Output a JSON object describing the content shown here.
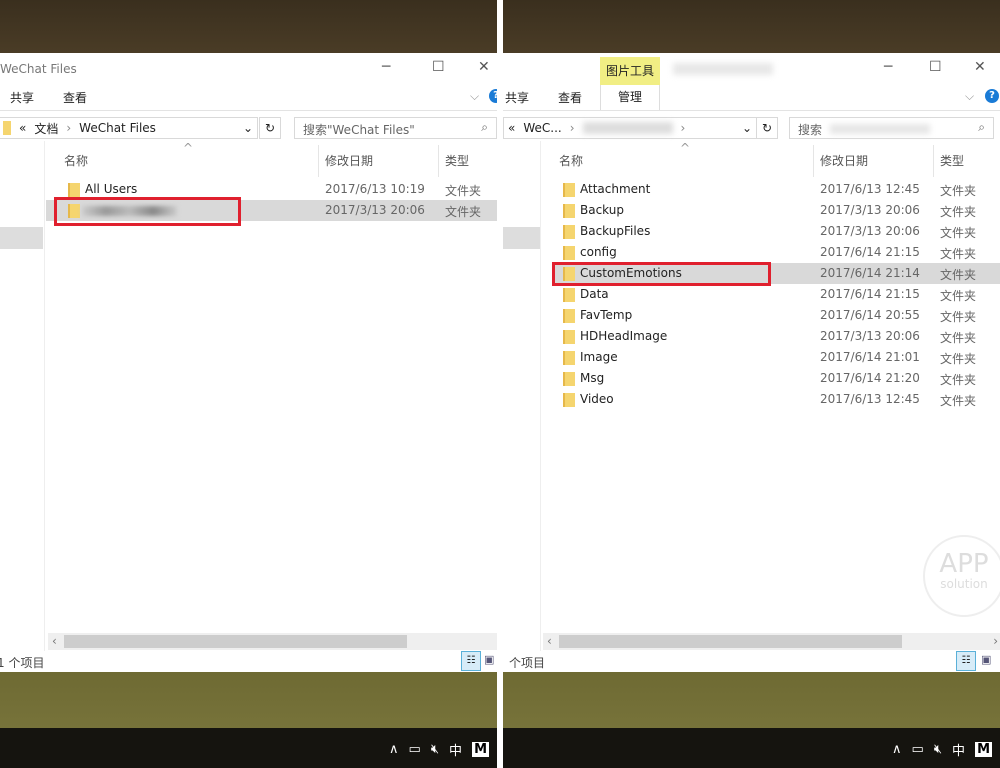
{
  "left": {
    "title": "WeChat Files",
    "ribbon": [
      "共享",
      "查看"
    ],
    "address": {
      "prefix": "«",
      "crumbs": [
        "文档",
        "WeChat Files"
      ]
    },
    "search_placeholder": "搜索\"WeChat Files\"",
    "columns": [
      "名称",
      "修改日期",
      "类型"
    ],
    "rows": [
      {
        "name": "All Users",
        "date": "2017/6/13 10:19",
        "type": "文件夹"
      },
      {
        "name": "",
        "date": "2017/3/13 20:06",
        "type": "文件夹",
        "selected": true,
        "highlighted": true
      }
    ],
    "status": "1 个项目"
  },
  "right": {
    "tool_tab": "图片工具",
    "manage_tab": "管理",
    "ribbon": [
      "共享",
      "查看"
    ],
    "address": {
      "prefix": "«",
      "crumbs": [
        "WeC..."
      ]
    },
    "search_placeholder": "搜索",
    "columns": [
      "名称",
      "修改日期",
      "类型"
    ],
    "rows": [
      {
        "name": "Attachment",
        "date": "2017/6/13 12:45",
        "type": "文件夹"
      },
      {
        "name": "Backup",
        "date": "2017/3/13 20:06",
        "type": "文件夹"
      },
      {
        "name": "BackupFiles",
        "date": "2017/3/13 20:06",
        "type": "文件夹"
      },
      {
        "name": "config",
        "date": "2017/6/14 21:15",
        "type": "文件夹"
      },
      {
        "name": "CustomEmotions",
        "date": "2017/6/14 21:14",
        "type": "文件夹",
        "selected": true,
        "highlighted": true
      },
      {
        "name": "Data",
        "date": "2017/6/14 21:15",
        "type": "文件夹"
      },
      {
        "name": "FavTemp",
        "date": "2017/6/14 20:55",
        "type": "文件夹"
      },
      {
        "name": "HDHeadImage",
        "date": "2017/3/13 20:06",
        "type": "文件夹"
      },
      {
        "name": "Image",
        "date": "2017/6/14 21:01",
        "type": "文件夹"
      },
      {
        "name": "Msg",
        "date": "2017/6/14 21:20",
        "type": "文件夹"
      },
      {
        "name": "Video",
        "date": "2017/6/13 12:45",
        "type": "文件夹"
      }
    ],
    "status": "个项目"
  },
  "tray": {
    "ime": "中",
    "app": "M"
  },
  "watermark": {
    "line1": "APP",
    "line2": "solution"
  }
}
